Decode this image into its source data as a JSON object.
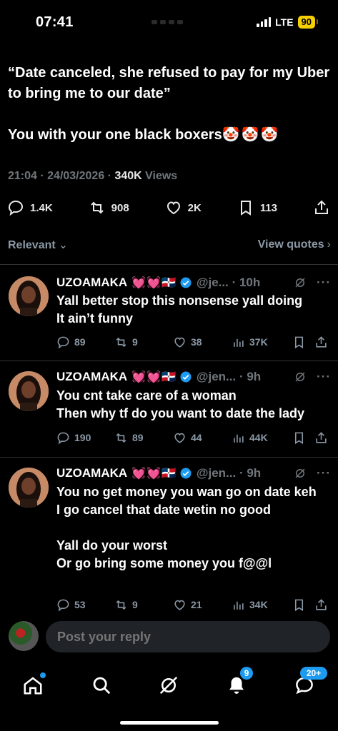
{
  "status_bar": {
    "time": "07:41",
    "network": "LTE",
    "battery": "90"
  },
  "tweet": {
    "text": "“Date canceled, she refused to pay for my Uber to bring me to our date”\n\nYou with your one black boxers",
    "emojis": "🤡🤡🤡",
    "timestamp": "21:04 · 24/03/2026 · ",
    "views_count": "340K",
    "views_label": " Views",
    "actions": {
      "replies": "1.4K",
      "reposts": "908",
      "likes": "2K",
      "bookmarks": "113"
    }
  },
  "sort": {
    "label": "Relevant",
    "view_quotes": "View quotes"
  },
  "replies": [
    {
      "name": "UZOAMAKA",
      "emojis": "💓💓🇩🇴",
      "handle": "@je... · 10h",
      "text": "Yall better stop this nonsense yall doing\nIt ain’t funny",
      "stats": {
        "replies": "89",
        "reposts": "9",
        "likes": "38",
        "views": "37K"
      }
    },
    {
      "name": "UZOAMAKA",
      "emojis": "💓💓🇩🇴",
      "handle": "@jen... · 9h",
      "text": "You cnt take care of a woman\nThen why tf do you want to date the lady",
      "stats": {
        "replies": "190",
        "reposts": "89",
        "likes": "44",
        "views": "44K"
      }
    },
    {
      "name": "UZOAMAKA",
      "emojis": "💓💓🇩🇴",
      "handle": "@jen... · 9h",
      "text": "You no get money you wan go on date keh\nI go cancel that date wetin no good\n\nYall do your worst\nOr go bring some money you f@@l",
      "stats": {
        "replies": "53",
        "reposts": "9",
        "likes": "21",
        "views": "34K"
      }
    }
  ],
  "composer": {
    "placeholder": "Post your reply"
  },
  "nav": {
    "notifications_badge": "9",
    "messages_badge": "20+"
  },
  "colors": {
    "accent": "#1d9bf0",
    "muted": "#71767b",
    "battery": "#f5d000"
  }
}
